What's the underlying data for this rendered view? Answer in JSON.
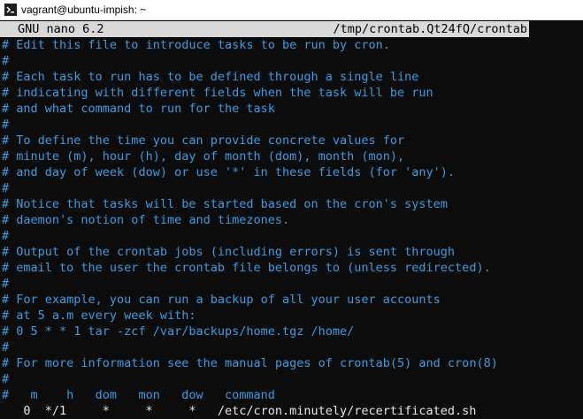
{
  "window": {
    "title": "vagrant@ubuntu-impish: ~"
  },
  "nano": {
    "version": "GNU nano 6.2",
    "filename": "/tmp/crontab.Qt24fQ/crontab"
  },
  "lines": [
    {
      "h": "#",
      "t": " Edit this file to introduce tasks to be run by cron."
    },
    {
      "h": "#",
      "t": ""
    },
    {
      "h": "#",
      "t": " Each task to run has to be defined through a single line"
    },
    {
      "h": "#",
      "t": " indicating with different fields when the task will be run"
    },
    {
      "h": "#",
      "t": " and what command to run for the task"
    },
    {
      "h": "#",
      "t": ""
    },
    {
      "h": "#",
      "t": " To define the time you can provide concrete values for"
    },
    {
      "h": "#",
      "t": " minute (m), hour (h), day of month (dom), month (mon),"
    },
    {
      "h": "#",
      "t": " and day of week (dow) or use '*' in these fields (for 'any')."
    },
    {
      "h": "#",
      "t": ""
    },
    {
      "h": "#",
      "t": " Notice that tasks will be started based on the cron's system"
    },
    {
      "h": "#",
      "t": " daemon's notion of time and timezones."
    },
    {
      "h": "#",
      "t": ""
    },
    {
      "h": "#",
      "t": " Output of the crontab jobs (including errors) is sent through"
    },
    {
      "h": "#",
      "t": " email to the user the crontab file belongs to (unless redirected)."
    },
    {
      "h": "#",
      "t": ""
    },
    {
      "h": "#",
      "t": " For example, you can run a backup of all your user accounts"
    },
    {
      "h": "#",
      "t": " at 5 a.m every week with:"
    },
    {
      "h": "#",
      "t": " 0 5 * * 1 tar -zcf /var/backups/home.tgz /home/"
    },
    {
      "h": "#",
      "t": ""
    },
    {
      "h": "#",
      "t": " For more information see the manual pages of crontab(5) and cron(8)"
    },
    {
      "h": "#",
      "t": ""
    },
    {
      "h": "#",
      "t": "   m    h   dom   mon   dow   command"
    }
  ],
  "command_line": "   0  */1     *     *     *   /etc/cron.minutely/recertificated.sh"
}
